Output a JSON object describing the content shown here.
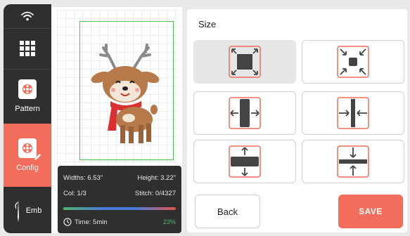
{
  "sidebar": {
    "items": [
      {
        "label": ""
      },
      {
        "label": ""
      },
      {
        "label": "Pattern"
      },
      {
        "label": "Config"
      },
      {
        "label": "Emb"
      }
    ],
    "active_color": "#f26d5b",
    "background_color": "#2f2f2f"
  },
  "canvas": {
    "hoop_color": "#4cc04c",
    "design": "deer-embroidery"
  },
  "info": {
    "width": "Widths: 6.53\"",
    "height": "Height: 3.22\"",
    "color": "Col: 1/3",
    "stitch": "Stitch: 0/4327",
    "time": "Time: 5min",
    "progress_percent": "23%",
    "progress_value": 0.23
  },
  "size_panel": {
    "title": "Size",
    "buttons": [
      {
        "icon": "expand-all-icon",
        "selected": true
      },
      {
        "icon": "shrink-all-icon",
        "selected": false
      },
      {
        "icon": "expand-horizontal-icon",
        "selected": false
      },
      {
        "icon": "shrink-horizontal-icon",
        "selected": false
      },
      {
        "icon": "expand-vertical-icon",
        "selected": false
      },
      {
        "icon": "shrink-vertical-icon",
        "selected": false
      }
    ],
    "back_label": "Back",
    "save_label": "SAVE",
    "accent_color": "#f26d5b"
  }
}
